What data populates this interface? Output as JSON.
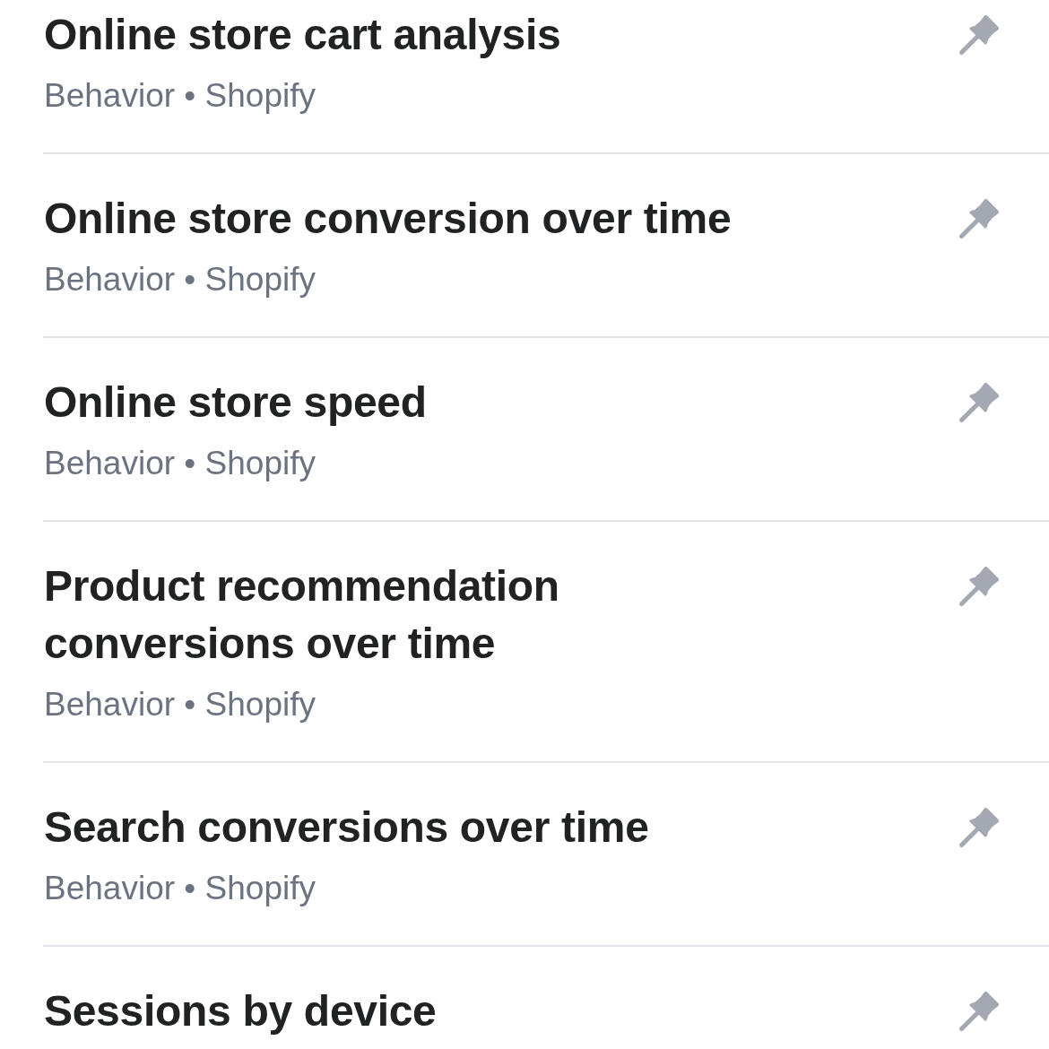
{
  "reports": [
    {
      "title": "Online store cart analysis",
      "meta": "Behavior • Shopify",
      "pinned": false
    },
    {
      "title": "Online store conversion over time",
      "meta": "Behavior • Shopify",
      "pinned": false
    },
    {
      "title": "Online store speed",
      "meta": "Behavior • Shopify",
      "pinned": false
    },
    {
      "title": "Product recommendation conversions over time",
      "meta": "Behavior • Shopify",
      "pinned": false
    },
    {
      "title": "Search conversions over time",
      "meta": "Behavior • Shopify",
      "pinned": false
    },
    {
      "title": "Sessions by device",
      "pinned": false
    }
  ]
}
